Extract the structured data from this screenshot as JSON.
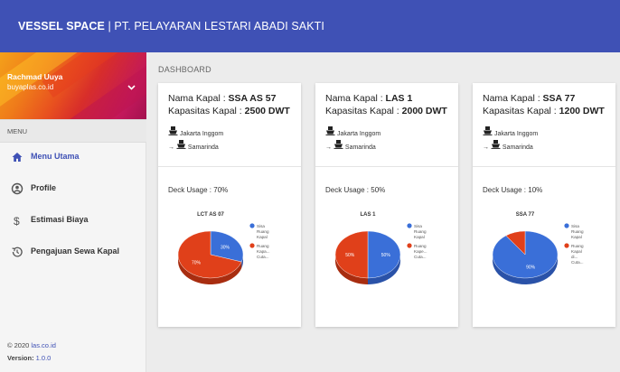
{
  "app": {
    "title_brand": "VESSEL SPACE",
    "title_rest": " | PT. PELAYARAN LESTARI ABADI SAKTI"
  },
  "user": {
    "name": "Rachmad Uuya",
    "email": "buyaplas.co.id"
  },
  "sidebar": {
    "menu_header": "MENU",
    "items": [
      {
        "label": "Menu Utama",
        "icon": "home-icon",
        "active": true
      },
      {
        "label": "Profile",
        "icon": "account-circle-icon",
        "active": false
      },
      {
        "label": "Estimasi Biaya",
        "icon": "dollar-icon",
        "active": false
      },
      {
        "label": "Pengajuan Sewa Kapal",
        "icon": "history-icon",
        "active": false
      }
    ],
    "footer_prefix": "© 2020 ",
    "footer_link": "las.co.id",
    "version_label": "Version:",
    "version_value": " 1.0.0"
  },
  "page": {
    "title": "DASHBOARD"
  },
  "cards": [
    {
      "name_label": "Nama Kapal : ",
      "name_value": "SSA AS 57",
      "cap_label": "Kapasitas Kapal : ",
      "cap_value": "2500 DWT",
      "origin": "Jakarta Inggom",
      "destination": "Samarinda",
      "usage": "Deck Usage : 70%"
    },
    {
      "name_label": "Nama Kapal : ",
      "name_value": "LAS 1",
      "cap_label": "Kapasitas Kapal : ",
      "cap_value": "2000 DWT",
      "origin": "Jakarta Inggom",
      "destination": "Samarinda",
      "usage": "Deck Usage : 50%"
    },
    {
      "name_label": "Nama Kapal : ",
      "name_value": "SSA 77",
      "cap_label": "Kapasitas Kapal : ",
      "cap_value": "1200 DWT",
      "origin": "Jakarta Inggom",
      "destination": "Samarinda",
      "usage": "Deck Usage : 10%"
    }
  ],
  "colors": {
    "primary": "#3f51b5",
    "free": "#3a6fd8",
    "used": "#e0401a"
  },
  "chart_data": [
    {
      "type": "pie",
      "title": "LCT AS 07",
      "labels": [
        "Sisa Ruang Kapal",
        "Ruang Kapal Terpakai"
      ],
      "legend_text": [
        "Sisa Ruang Kapal",
        "Ruang Kapa... Cuta..."
      ],
      "values": [
        30,
        70
      ],
      "slice_labels": [
        "30%",
        "70%"
      ],
      "legend_position": "right"
    },
    {
      "type": "pie",
      "title": "LAS 1",
      "labels": [
        "Sisa Ruang Kapal",
        "Ruang Kapal Terpakai"
      ],
      "legend_text": [
        "Sisa Ruang Kapal",
        "Ruang Kape... Cuta..."
      ],
      "values": [
        50,
        50
      ],
      "slice_labels": [
        "50%",
        "50%"
      ],
      "legend_position": "right"
    },
    {
      "type": "pie",
      "title": "SSA 77",
      "labels": [
        "Sisa Ruang Kapal",
        "Ruang Kapal Terpakai"
      ],
      "legend_text": [
        "Sisa Ruang Kapal",
        "Ruang Kapal di... Cuta..."
      ],
      "values": [
        90,
        10
      ],
      "slice_labels": [
        "90%",
        ""
      ],
      "legend_position": "right"
    }
  ]
}
